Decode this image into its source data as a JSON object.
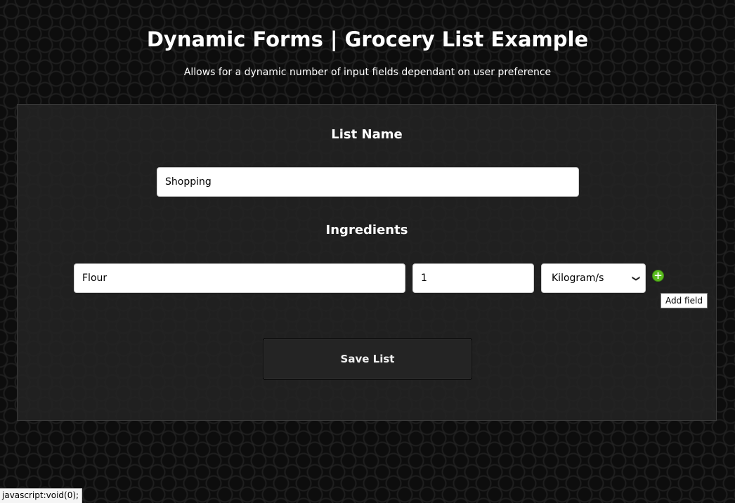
{
  "header": {
    "title": "Dynamic Forms | Grocery List Example",
    "subtitle": "Allows for a dynamic number of input fields dependant on user preference"
  },
  "form": {
    "list_name_heading": "List Name",
    "list_name_value": "Shopping",
    "ingredients_heading": "Ingredients",
    "ingredients": [
      {
        "name": "Flour",
        "quantity": "1",
        "unit": "Kilogram/s"
      }
    ],
    "add_field_icon": "plus-circle-icon",
    "add_field_tooltip": "Add field",
    "save_label": "Save List"
  },
  "status_bar": {
    "text": "javascript:void(0);"
  },
  "colors": {
    "background": "#0d0d0d",
    "panel": "#232323",
    "add_button": "#5cbc1f",
    "save_button": "#242424"
  }
}
